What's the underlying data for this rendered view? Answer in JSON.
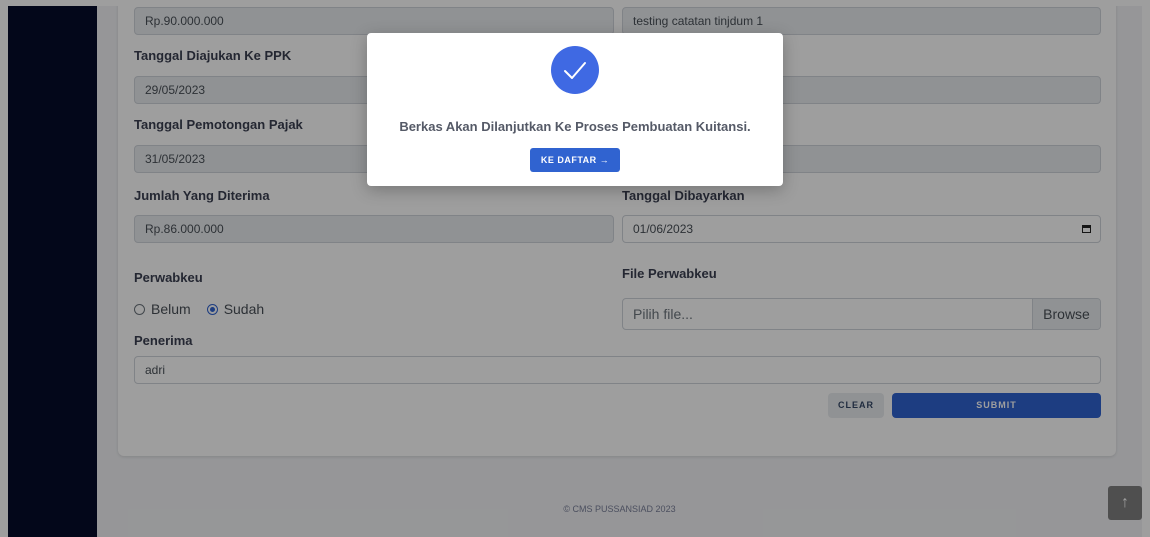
{
  "form": {
    "row0": {
      "left_value": "Rp.90.000.000",
      "right_value": "testing catatan tinjdum 1"
    },
    "tanggal_ppk": {
      "label": "Tanggal Diajukan Ke PPK",
      "value": "29/05/2023"
    },
    "tanggal_pajak": {
      "label": "Tanggal Pemotongan Pajak",
      "value": "31/05/2023"
    },
    "jumlah": {
      "label": "Jumlah Yang Diterima",
      "value": "Rp.86.000.000"
    },
    "tanggal_bayar": {
      "label": "Tanggal Dibayarkan",
      "value": "01/06/2023"
    },
    "perwabkeu": {
      "label": "Perwabkeu",
      "options": [
        "Belum",
        "Sudah"
      ],
      "selected": "Sudah"
    },
    "file_perwabkeu": {
      "label": "File Perwabkeu",
      "placeholder": "Pilih file...",
      "browse_label": "Browse"
    },
    "penerima": {
      "label": "Penerima",
      "value": "adri"
    },
    "clear_label": "CLEAR",
    "submit_label": "SUBMIT"
  },
  "footer": {
    "text": "© CMS PUSSANSIAD 2023"
  },
  "scroll_top": {
    "icon": "arrow-up-icon",
    "glyph": "↑"
  },
  "modal": {
    "icon": "check-icon",
    "message": "Berkas Akan Dilanjutkan Ke Proses Pembuatan Kuitansi.",
    "button_label": "KE DAFTAR →"
  },
  "colors": {
    "sidebar": "#050c2b",
    "primary": "#3063d0",
    "success_icon": "#3f69e3"
  }
}
